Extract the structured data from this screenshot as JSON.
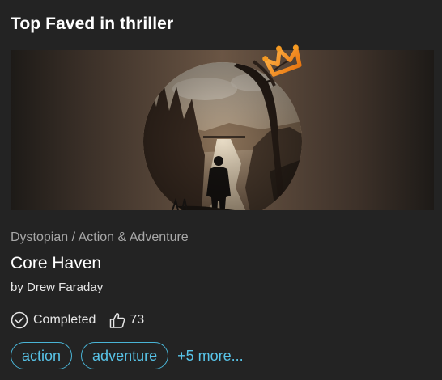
{
  "section": {
    "title": "Top Faved in thriller"
  },
  "book": {
    "genre": "Dystopian / Action & Adventure",
    "title": "Core Haven",
    "author": "by Drew Faraday",
    "status": "Completed",
    "likes": "73"
  },
  "tags": {
    "items": [
      "action",
      "adventure"
    ],
    "more": "+5 more..."
  },
  "icons": {
    "badge": "crown-icon",
    "status": "check-circle-icon",
    "likes": "thumbs-up-icon"
  },
  "colors": {
    "background": "#232323",
    "tag_accent": "#58c4e8",
    "crown": "#f59a23",
    "muted_text": "#a8a8a8"
  }
}
